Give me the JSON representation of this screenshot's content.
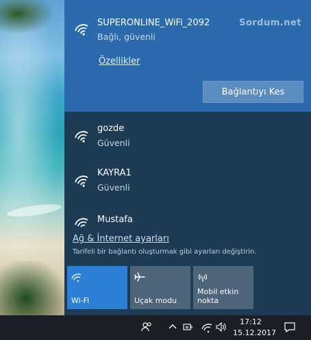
{
  "flyout": {
    "connected": {
      "name": "SUPERONLINE_WiFi_2092",
      "status": "Bağlı, güvenli",
      "properties_label": "Özellikler",
      "disconnect_label": "Bağlantıyı Kes"
    },
    "watermark": "Sordum.net",
    "networks": [
      {
        "name": "gozde",
        "status": "Güvenli"
      },
      {
        "name": "KAYRA1",
        "status": "Güvenli"
      },
      {
        "name": "Mustafa",
        "status": ""
      }
    ],
    "settings_link": "Ağ & İnternet ayarları",
    "settings_desc": "Tarifeli bir bağlantı oluşturmak gibi ayarları değiştirin.",
    "tiles": [
      {
        "label": "Wi-Fi",
        "icon": "wifi-icon",
        "active": true
      },
      {
        "label": "Uçak modu",
        "icon": "airplane-icon",
        "active": false
      },
      {
        "label": "Mobil etkin nokta",
        "label_line1": "Mobil etkin",
        "label_line2": "nokta",
        "icon": "hotspot-icon",
        "active": false
      }
    ]
  },
  "taskbar": {
    "time": "17:12",
    "date": "15.12.2017",
    "tray_icons": [
      "people-icon",
      "chevron-up-icon",
      "power-plug-icon",
      "wifi-icon",
      "volume-icon",
      "notification-icon"
    ]
  },
  "colors": {
    "connected_bg": "#2b6aad",
    "flyout_bg": "#1d3b55",
    "active_tile": "#2d7fd6",
    "inactive_tile": "#4e6478",
    "taskbar": "#1b1e24"
  }
}
